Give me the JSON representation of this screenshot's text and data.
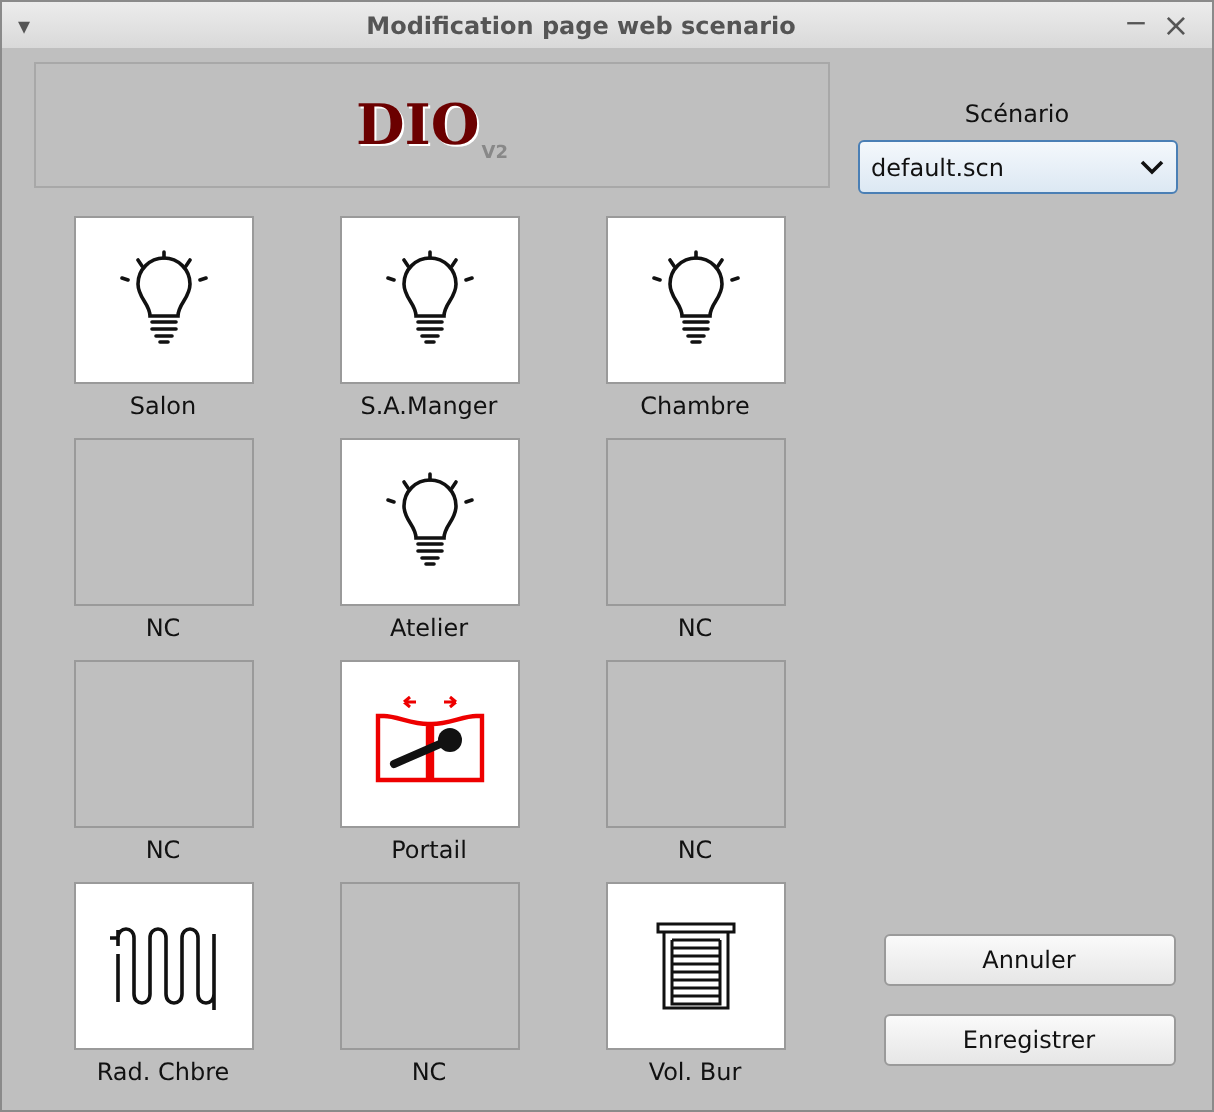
{
  "window": {
    "title": "Modification page web scenario",
    "menu_glyph": "▾",
    "minimize_glyph": "−",
    "close_glyph": "×"
  },
  "logo": {
    "text": "DIO",
    "version": "V2"
  },
  "scenario": {
    "label": "Scénario",
    "value": "default.scn"
  },
  "tiles": [
    {
      "label": "Salon",
      "kind": "light"
    },
    {
      "label": "S.A.Manger",
      "kind": "light"
    },
    {
      "label": "Chambre",
      "kind": "light"
    },
    {
      "label": "NC",
      "kind": "empty"
    },
    {
      "label": "Atelier",
      "kind": "light"
    },
    {
      "label": "NC",
      "kind": "empty"
    },
    {
      "label": "NC",
      "kind": "empty"
    },
    {
      "label": "Portail",
      "kind": "gate"
    },
    {
      "label": "NC",
      "kind": "empty"
    },
    {
      "label": "Rad. Chbre",
      "kind": "radiator"
    },
    {
      "label": "NC",
      "kind": "empty"
    },
    {
      "label": "Vol. Bur",
      "kind": "shutter"
    }
  ],
  "buttons": [
    "Annuler",
    "Enregistrer"
  ]
}
